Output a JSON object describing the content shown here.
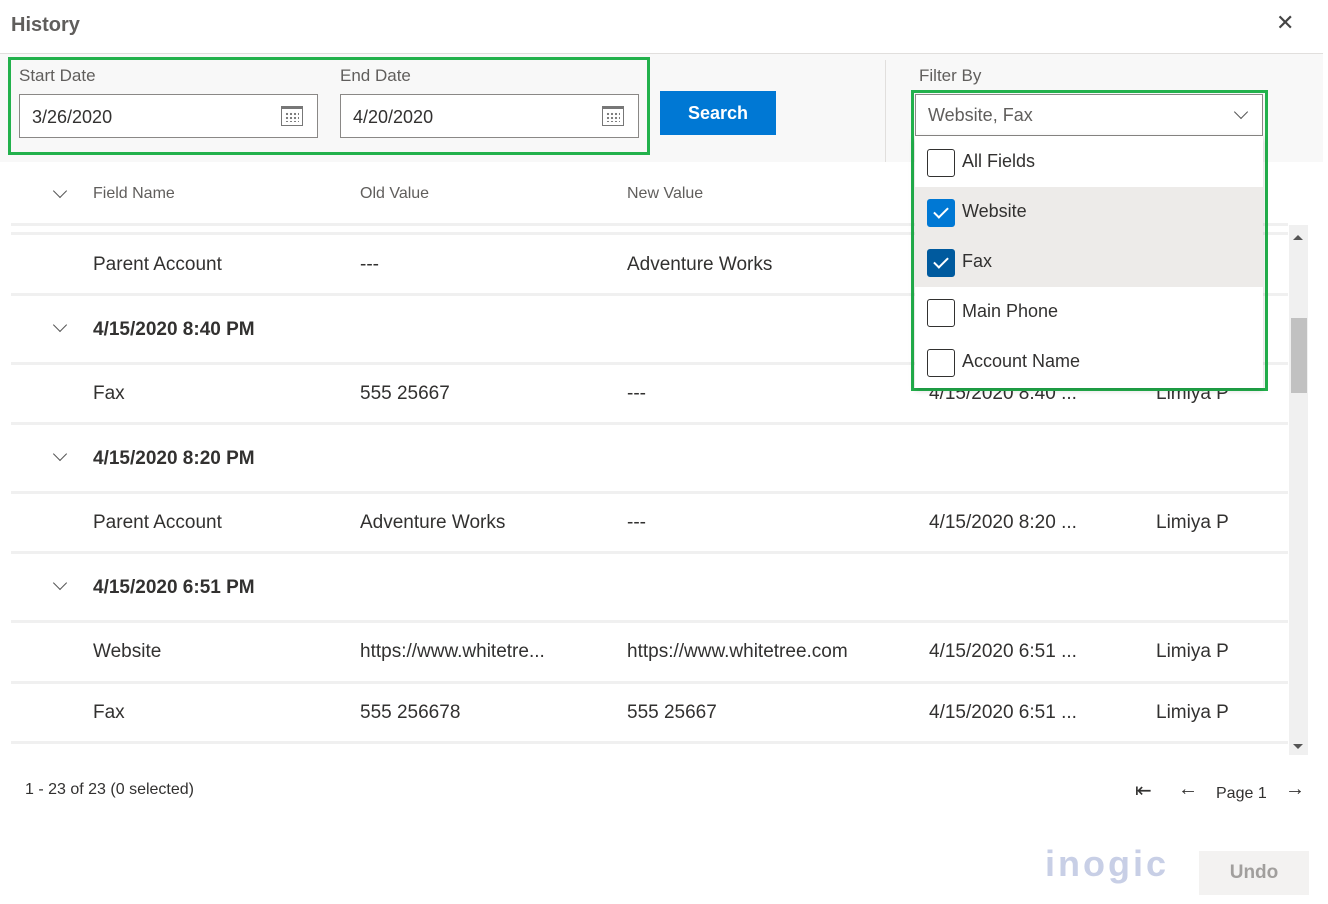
{
  "dialog": {
    "title": "History",
    "close_icon": "close-icon"
  },
  "filters": {
    "start_label": "Start Date",
    "start_value": "3/26/2020",
    "end_label": "End Date",
    "end_value": "4/20/2020",
    "search_label": "Search",
    "filter_label": "Filter By",
    "filter_value": "Website, Fax",
    "options": [
      {
        "label": "All Fields",
        "checked": false
      },
      {
        "label": "Website",
        "checked": true
      },
      {
        "label": "Fax",
        "checked": true
      },
      {
        "label": "Main Phone",
        "checked": false
      },
      {
        "label": "Account Name",
        "checked": false
      }
    ]
  },
  "table": {
    "columns": [
      "Field Name",
      "Old Value",
      "New Value"
    ],
    "rows": [
      {
        "type": "item",
        "field": "Parent Account",
        "old": "---",
        "new": "Adventure Works",
        "date": "",
        "user": ""
      },
      {
        "type": "group",
        "label": "4/15/2020 8:40 PM"
      },
      {
        "type": "item",
        "field": "Fax",
        "old": "555 25667",
        "new": "---",
        "date": "4/15/2020 8:40 ...",
        "user": "Limiya P"
      },
      {
        "type": "group",
        "label": "4/15/2020 8:20 PM"
      },
      {
        "type": "item",
        "field": "Parent Account",
        "old": "Adventure Works",
        "new": "---",
        "date": "4/15/2020 8:20 ...",
        "user": "Limiya P"
      },
      {
        "type": "group",
        "label": "4/15/2020 6:51 PM"
      },
      {
        "type": "item",
        "field": "Website",
        "old": "https://www.whitetre...",
        "new": "https://www.whitetree.com",
        "date": "4/15/2020 6:51 ...",
        "user": "Limiya P"
      },
      {
        "type": "item",
        "field": "Fax",
        "old": "555 256678",
        "new": "555 25667",
        "date": "4/15/2020 6:51 ...",
        "user": "Limiya P"
      }
    ]
  },
  "footer": {
    "count": "1 - 23 of 23 (0 selected)",
    "page": "Page 1",
    "undo": "Undo",
    "logo": "inogic"
  },
  "colors": {
    "accent": "#0078d4",
    "highlight": "#22b14c"
  }
}
